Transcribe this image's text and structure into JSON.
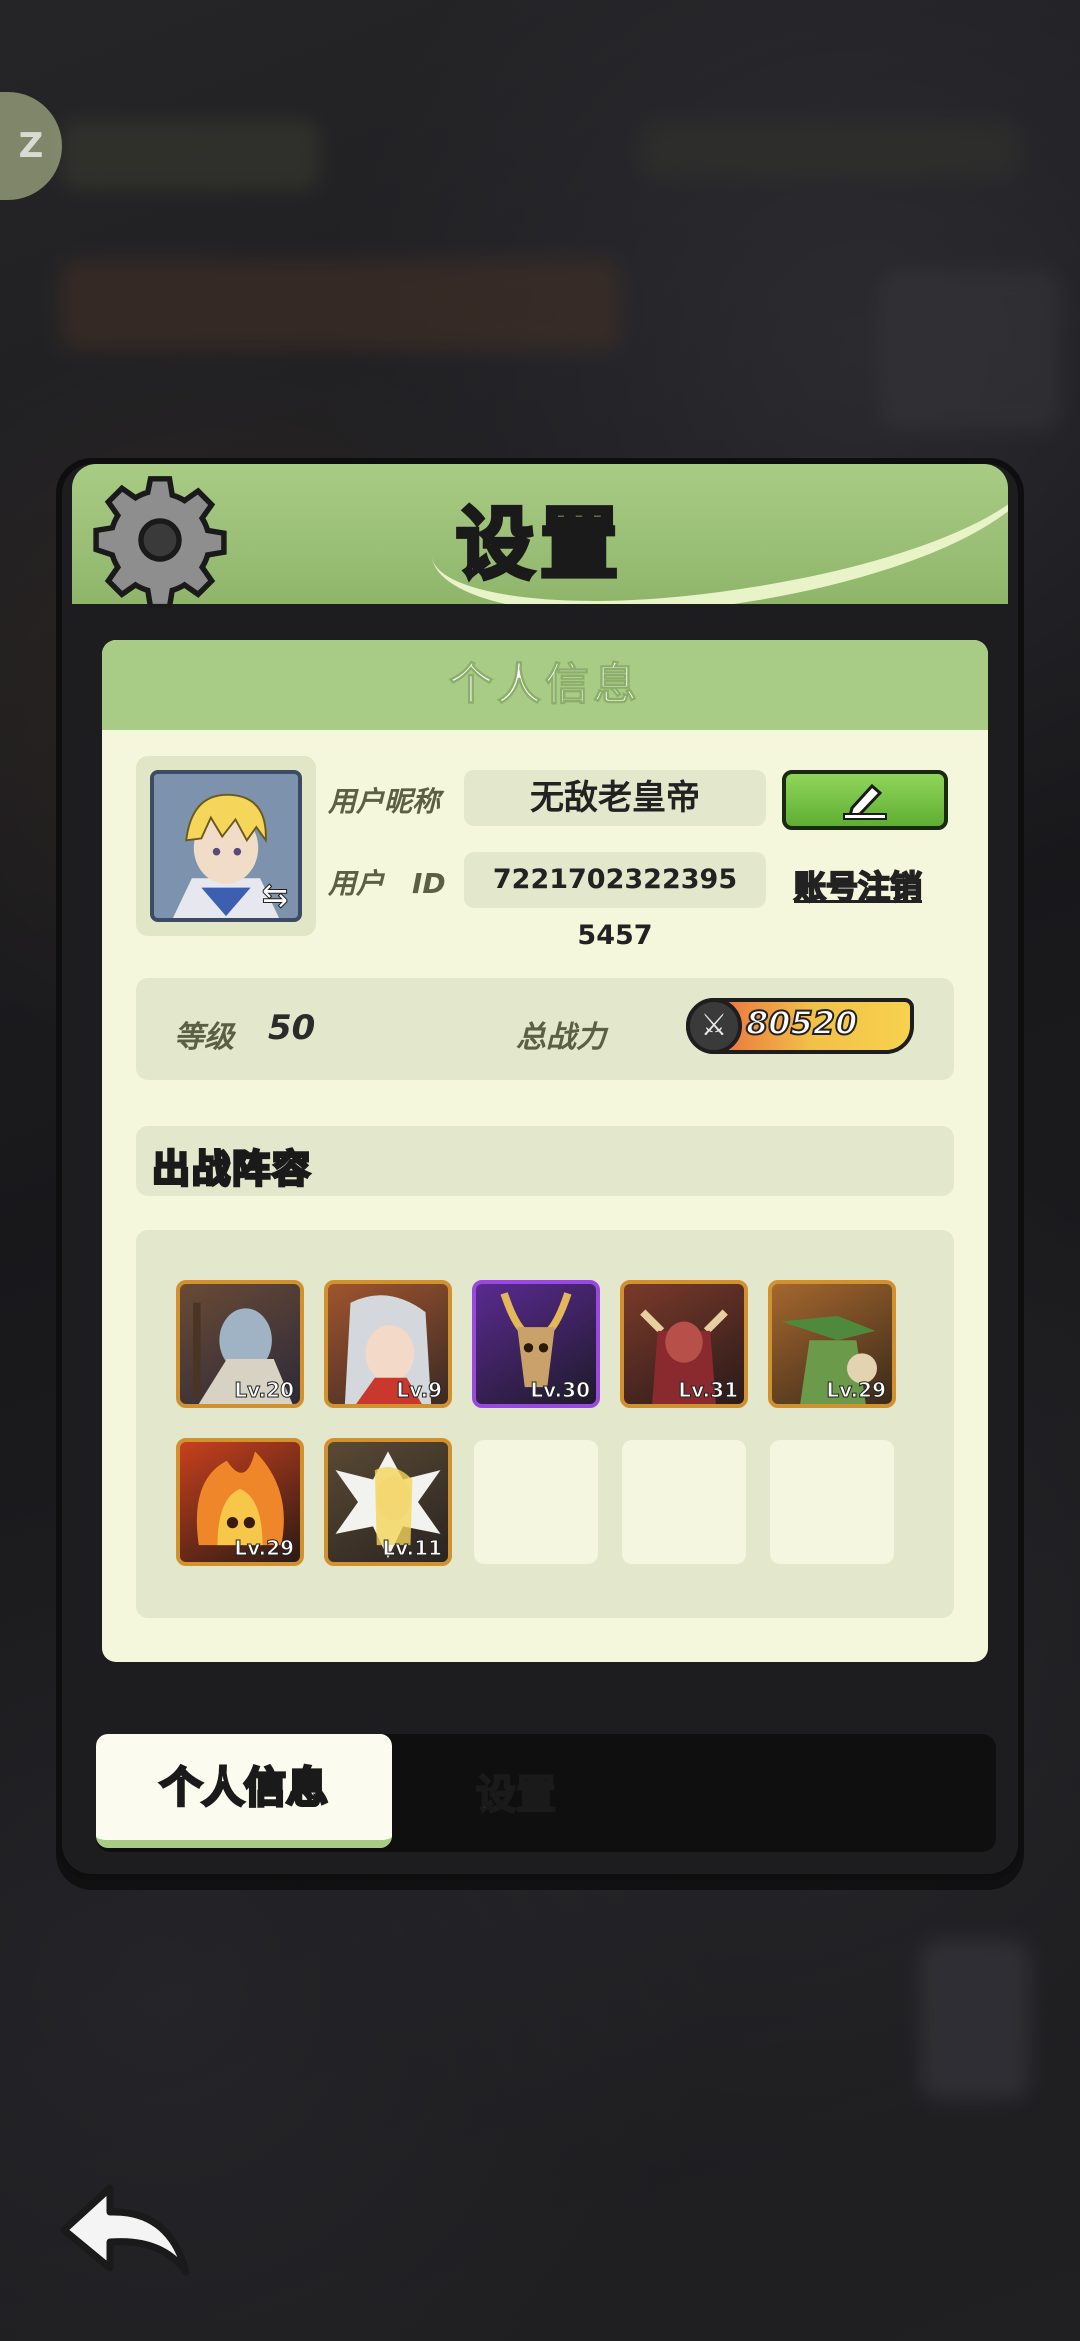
{
  "dialog": {
    "title": "设置"
  },
  "profile": {
    "section_title": "个人信息",
    "nickname_label": "用户昵称",
    "nickname_value": "无敌老皇帝",
    "userid_label": "用户　ID",
    "userid_value": "7221702322395 5457",
    "logout_label": "账号注销",
    "edit_icon": "pencil-icon",
    "avatar_icon": "swap-icon"
  },
  "stats": {
    "level_label": "等级",
    "level_value": "50",
    "power_label": "总战力",
    "power_value": "80520"
  },
  "lineup": {
    "title": "出战阵容",
    "heroes": [
      {
        "level": "Lv.20",
        "frame": "orange"
      },
      {
        "level": "Lv.9",
        "frame": "orange"
      },
      {
        "level": "Lv.30",
        "frame": "purple"
      },
      {
        "level": "Lv.31",
        "frame": "orange"
      },
      {
        "level": "Lv.29",
        "frame": "orange"
      },
      {
        "level": "Lv.29",
        "frame": "orange"
      },
      {
        "level": "Lv.11",
        "frame": "orange"
      }
    ],
    "empty_slots": 3
  },
  "tabs": [
    {
      "label": "个人信息",
      "active": true
    },
    {
      "label": "设置",
      "active": false
    }
  ],
  "colors": {
    "header_green": "#a8cc86",
    "card_bg": "#f5f7dc",
    "field_bg": "#e3e7cb",
    "frame_orange": "#d2912f",
    "frame_purple": "#9a48e0"
  }
}
